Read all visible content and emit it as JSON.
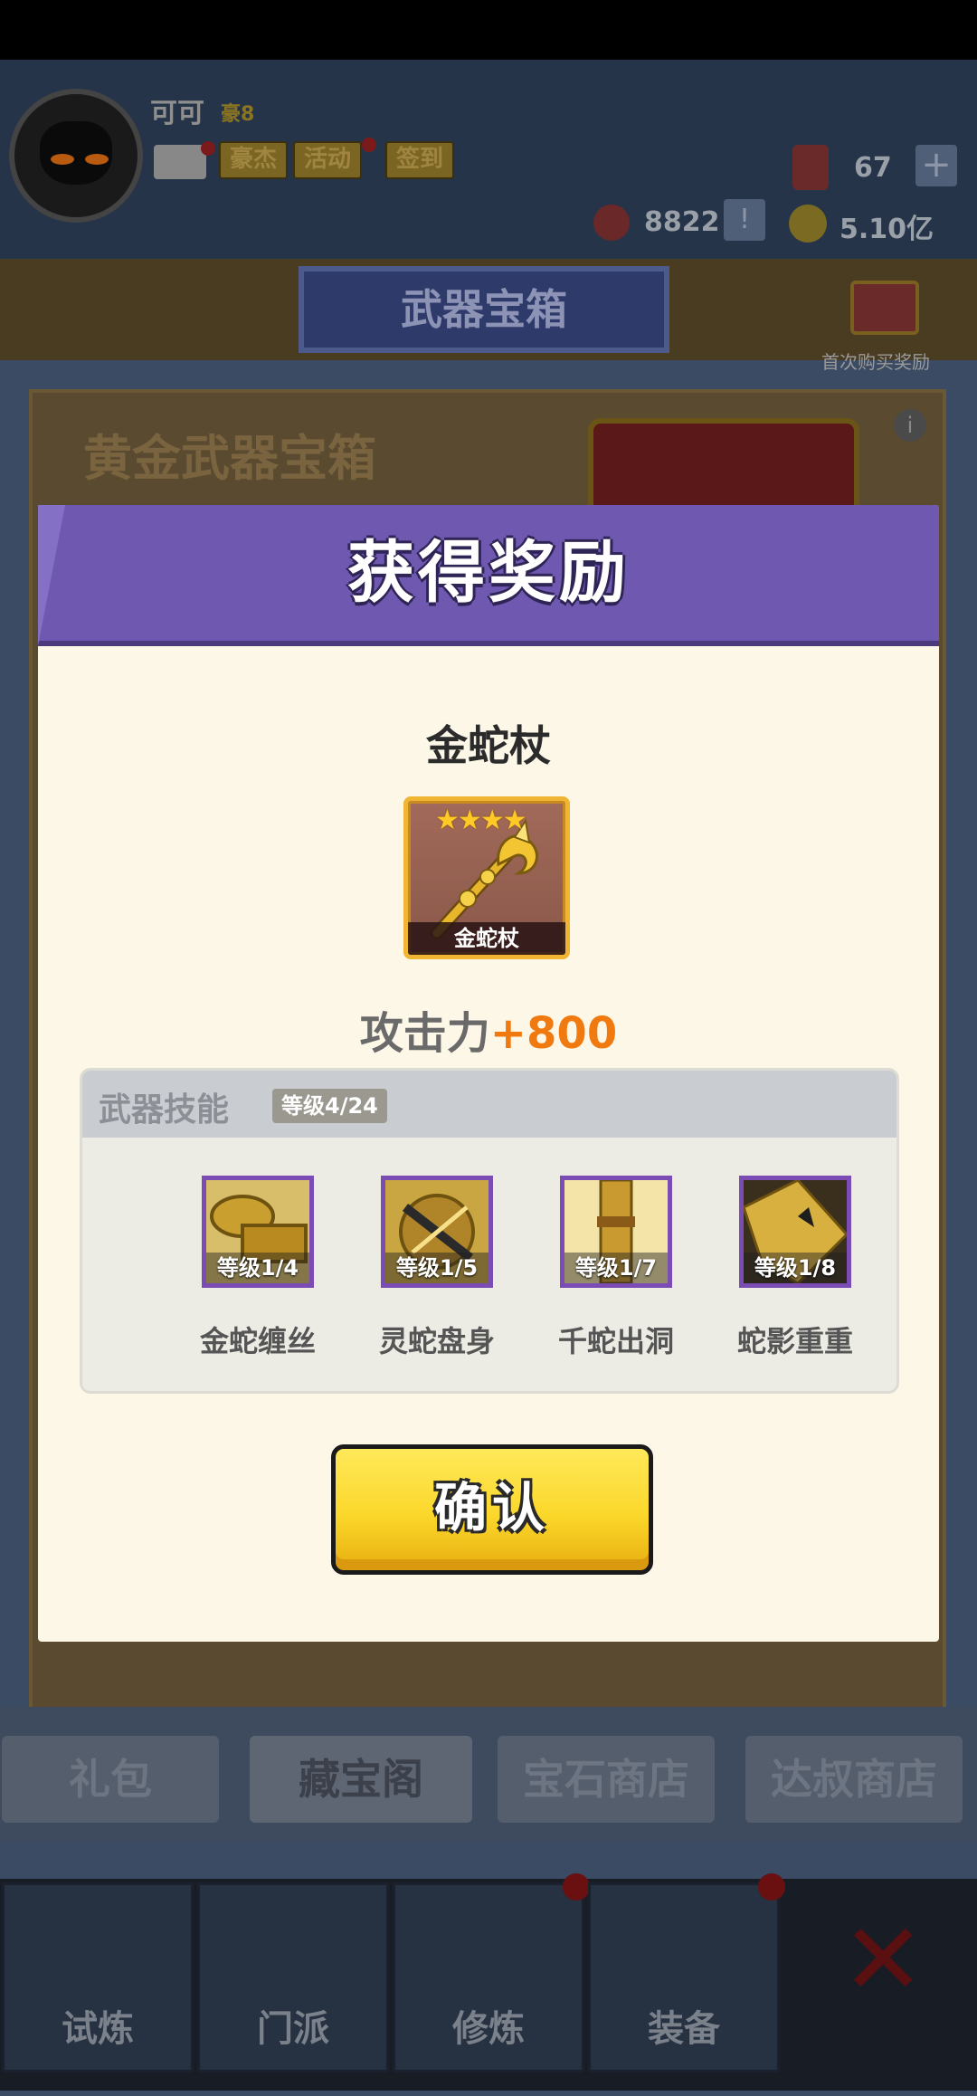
{
  "player": {
    "name": "可可",
    "vip": "豪8"
  },
  "header_buttons": {
    "hero": "豪杰",
    "activity": "活动",
    "signin": "签到"
  },
  "resources": {
    "gems": "67",
    "tokens": "8822",
    "gold": "5.10亿"
  },
  "page": {
    "title": "武器宝箱",
    "first_purchase": "首次购买奖励",
    "chest_title": "黄金武器宝箱"
  },
  "shop_tabs": [
    "礼包",
    "藏宝阁",
    "宝石商店",
    "达叔商店"
  ],
  "nav": [
    "试炼",
    "门派",
    "修炼",
    "装备"
  ],
  "modal": {
    "title": "获得奖励",
    "item_name": "金蛇杖",
    "item_label": "金蛇杖",
    "stars": "★★★★",
    "attack_label": "攻击力",
    "attack_value": "+800",
    "skills_title": "武器技能",
    "skills_level": "等级4/24",
    "skills": [
      {
        "name": "金蛇缠丝",
        "level": "等级1/4"
      },
      {
        "name": "灵蛇盘身",
        "level": "等级1/5"
      },
      {
        "name": "千蛇出洞",
        "level": "等级1/7"
      },
      {
        "name": "蛇影重重",
        "level": "等级1/8"
      }
    ],
    "confirm": "确认"
  },
  "colors": {
    "modal_header": "#6f58b0",
    "attack_value": "#f07a10",
    "confirm_yellow": "#fbd72a",
    "skill_border": "#7a4cb4"
  }
}
